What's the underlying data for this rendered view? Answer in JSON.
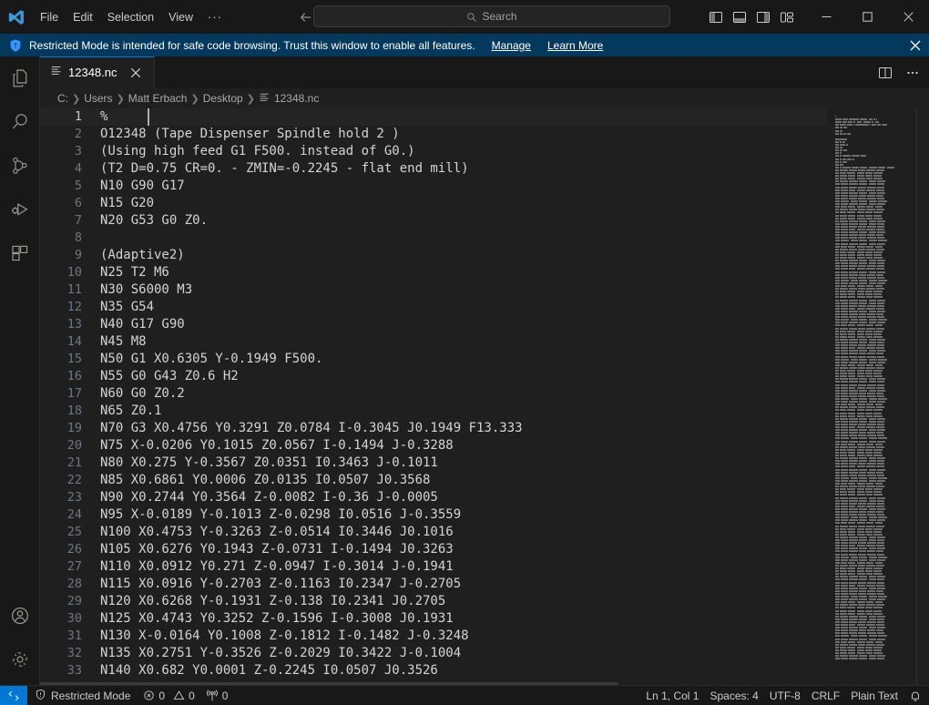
{
  "window": {
    "logo_icon": "vscode-logo",
    "menu": [
      "File",
      "Edit",
      "Selection",
      "View"
    ],
    "menu_overflow": "···",
    "nav_back_icon": "arrow-left-icon",
    "nav_forward_icon": "arrow-right-icon",
    "accent_color": "#0078d4"
  },
  "search": {
    "placeholder": "Search",
    "icon": "search-icon"
  },
  "layout_buttons": [
    {
      "name": "toggle-primary-sidebar",
      "icon": "layout-sidebar-left-icon"
    },
    {
      "name": "toggle-panel",
      "icon": "layout-panel-bottom-icon"
    },
    {
      "name": "toggle-secondary-sidebar",
      "icon": "layout-sidebar-right-icon"
    },
    {
      "name": "customize-layout",
      "icon": "layout-customize-icon"
    }
  ],
  "window_controls": [
    {
      "name": "minimize-button",
      "icon": "minimize-icon",
      "glyph": "–"
    },
    {
      "name": "maximize-button",
      "icon": "maximize-icon",
      "glyph": "□"
    },
    {
      "name": "close-button",
      "icon": "close-icon",
      "glyph": "✕"
    }
  ],
  "banner": {
    "icon": "shield-icon",
    "message": "Restricted Mode is intended for safe code browsing. Trust this window to enable all features.",
    "links": [
      "Manage",
      "Learn More"
    ],
    "close_icon": "close-icon",
    "background": "#04395e"
  },
  "activity_bar": {
    "top_items": [
      {
        "name": "sidebar-item-explorer",
        "icon": "files-icon",
        "active": false
      },
      {
        "name": "sidebar-item-search",
        "icon": "search-icon",
        "active": false
      },
      {
        "name": "sidebar-item-source-control",
        "icon": "source-control-icon",
        "active": false
      },
      {
        "name": "sidebar-item-run-and-debug",
        "icon": "run-debug-icon",
        "active": false
      },
      {
        "name": "sidebar-item-extensions",
        "icon": "extensions-icon",
        "active": false
      }
    ],
    "bottom_items": [
      {
        "name": "account-button",
        "icon": "account-icon"
      },
      {
        "name": "manage-settings-button",
        "icon": "gear-icon"
      }
    ]
  },
  "editor": {
    "tabs": [
      {
        "label": "12348.nc",
        "icon": "plain-text-file-icon",
        "close_icon": "close-icon",
        "active": true
      }
    ],
    "tab_actions": [
      {
        "name": "split-editor-right-button",
        "icon": "split-editor-icon"
      },
      {
        "name": "more-editor-actions-button",
        "icon": "ellipsis-icon"
      }
    ],
    "breadcrumb": {
      "segments": [
        "C:",
        "Users",
        "Matt Erbach",
        "Desktop"
      ],
      "separator": "❯",
      "file": "12348.nc",
      "file_icon": "plain-text-file-icon"
    },
    "current_line": 1,
    "code_lines": [
      "%",
      "O12348 (Tape Dispenser Spindle hold 2 )",
      "(Using high feed G1 F500. instead of G0.)",
      "(T2 D=0.75 CR=0. - ZMIN=-0.2245 - flat end mill)",
      "N10 G90 G17",
      "N15 G20",
      "N20 G53 G0 Z0.",
      "",
      "(Adaptive2)",
      "N25 T2 M6",
      "N30 S6000 M3",
      "N35 G54",
      "N40 G17 G90",
      "N45 M8",
      "N50 G1 X0.6305 Y-0.1949 F500.",
      "N55 G0 G43 Z0.6 H2",
      "N60 G0 Z0.2",
      "N65 Z0.1",
      "N70 G3 X0.4756 Y0.3291 Z0.0784 I-0.3045 J0.1949 F13.333",
      "N75 X-0.0206 Y0.1015 Z0.0567 I-0.1494 J-0.3288",
      "N80 X0.275 Y-0.3567 Z0.0351 I0.3463 J-0.1011",
      "N85 X0.6861 Y0.0006 Z0.0135 I0.0507 J0.3568",
      "N90 X0.2744 Y0.3564 Z-0.0082 I-0.36 J-0.0005",
      "N95 X-0.0189 Y-0.1013 Z-0.0298 I0.0516 J-0.3559",
      "N100 X0.4753 Y-0.3263 Z-0.0514 I0.3446 J0.1016",
      "N105 X0.6276 Y0.1943 Z-0.0731 I-0.1494 J0.3263",
      "N110 X0.0912 Y0.271 Z-0.0947 I-0.3014 J-0.1941",
      "N115 X0.0916 Y-0.2703 Z-0.1163 I0.2347 J-0.2705",
      "N120 X0.6268 Y-0.1931 Z-0.138 I0.2341 J0.2705",
      "N125 X0.4743 Y0.3252 Z-0.1596 I-0.3008 J0.1931",
      "N130 X-0.0164 Y0.1008 Z-0.1812 I-0.1482 J-0.3248",
      "N135 X0.2751 Y-0.3526 Z-0.2029 I0.3422 J-0.1004",
      "N140 X0.682 Y0.0001 Z-0.2245 I0.0507 J0.3526"
    ],
    "minimap_visible": true
  },
  "status_bar": {
    "remote_icon": "remote-window-icon",
    "restricted_mode": {
      "label": "Restricted Mode",
      "icon": "shield-icon"
    },
    "problems": {
      "errors_icon": "error-icon",
      "errors": "0",
      "warnings_icon": "warning-icon",
      "warnings": "0"
    },
    "ports": {
      "icon": "radio-tower-icon",
      "count": "0"
    },
    "right_items": [
      {
        "name": "editor-selection-status",
        "label": "Ln 1, Col 1"
      },
      {
        "name": "editor-indentation-status",
        "label": "Spaces: 4"
      },
      {
        "name": "editor-encoding-status",
        "label": "UTF-8"
      },
      {
        "name": "editor-eol-status",
        "label": "CRLF"
      },
      {
        "name": "editor-language-status",
        "label": "Plain Text"
      }
    ],
    "notifications_icon": "bell-icon"
  }
}
